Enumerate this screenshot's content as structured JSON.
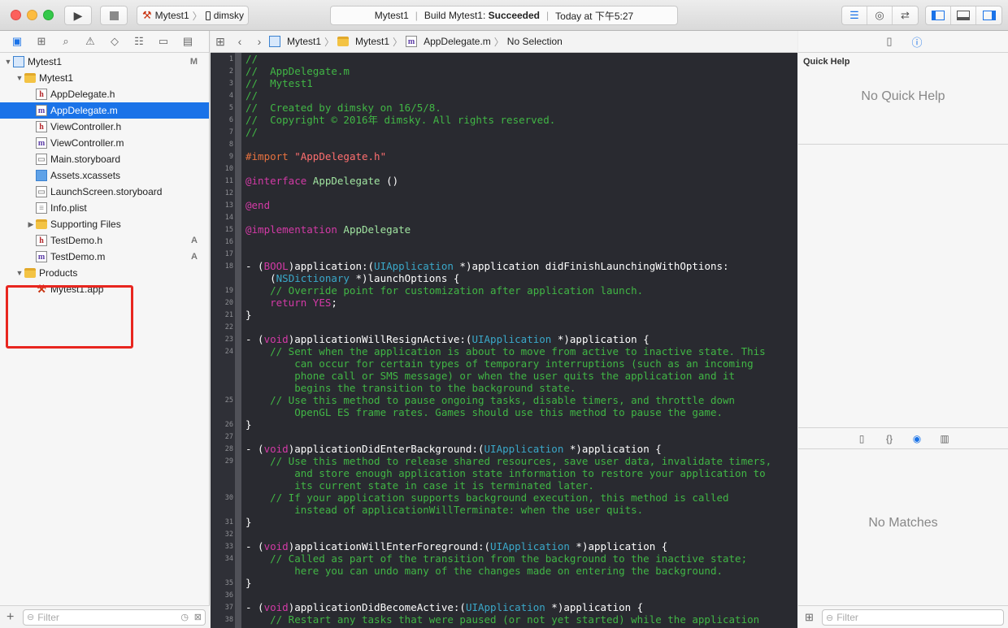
{
  "toolbar": {
    "scheme_name": "Mytest1",
    "device_name": "dimsky",
    "activity_project": "Mytest1",
    "activity_status_prefix": "Build Mytest1:",
    "activity_status": "Succeeded",
    "activity_time": "Today at 下午5:27"
  },
  "navigator": {
    "tabs": [
      "folder-icon",
      "hierarchy-icon",
      "search-icon",
      "warning-icon",
      "test-icon",
      "debug-icon",
      "breakpoint-icon",
      "report-icon"
    ],
    "items": [
      {
        "label": "Mytest1",
        "type": "project",
        "badge": "M"
      },
      {
        "label": "Mytest1",
        "type": "folder",
        "badge": ""
      },
      {
        "label": "AppDelegate.h",
        "type": "h",
        "badge": ""
      },
      {
        "label": "AppDelegate.m",
        "type": "m",
        "badge": ""
      },
      {
        "label": "ViewController.h",
        "type": "h",
        "badge": ""
      },
      {
        "label": "ViewController.m",
        "type": "m",
        "badge": ""
      },
      {
        "label": "Main.storyboard",
        "type": "storyboard",
        "badge": ""
      },
      {
        "label": "Assets.xcassets",
        "type": "xcassets",
        "badge": ""
      },
      {
        "label": "LaunchScreen.storyboard",
        "type": "storyboard",
        "badge": ""
      },
      {
        "label": "Info.plist",
        "type": "plist",
        "badge": ""
      },
      {
        "label": "Supporting Files",
        "type": "folder",
        "badge": ""
      },
      {
        "label": "TestDemo.h",
        "type": "h",
        "badge": "A"
      },
      {
        "label": "TestDemo.m",
        "type": "m",
        "badge": "A"
      },
      {
        "label": "Products",
        "type": "folder",
        "badge": ""
      },
      {
        "label": "Mytest1.app",
        "type": "app",
        "badge": ""
      }
    ],
    "filter_placeholder": "Filter"
  },
  "jumpbar": {
    "project": "Mytest1",
    "group": "Mytest1",
    "file": "AppDelegate.m",
    "selection": "No Selection"
  },
  "editor": {
    "lines": [
      {
        "n": "1",
        "text": "//"
      },
      {
        "n": "2",
        "text": "//  AppDelegate.m"
      },
      {
        "n": "3",
        "text": "//  Mytest1"
      },
      {
        "n": "4",
        "text": "//"
      },
      {
        "n": "5",
        "text": "//  Created by dimsky on 16/5/8."
      },
      {
        "n": "6",
        "text": "//  Copyright © 2016年 dimsky. All rights reserved."
      },
      {
        "n": "7",
        "text": "//"
      },
      {
        "n": "8",
        "text": ""
      },
      {
        "n": "9",
        "text": "#import \"AppDelegate.h\""
      },
      {
        "n": "10",
        "text": ""
      },
      {
        "n": "11",
        "text": "@interface AppDelegate ()"
      },
      {
        "n": "12",
        "text": ""
      },
      {
        "n": "13",
        "text": "@end"
      },
      {
        "n": "14",
        "text": ""
      },
      {
        "n": "15",
        "text": "@implementation AppDelegate"
      },
      {
        "n": "16",
        "text": ""
      },
      {
        "n": "17",
        "text": ""
      },
      {
        "n": "18",
        "text": "- (BOOL)application:(UIApplication *)application didFinishLaunchingWithOptions:"
      },
      {
        "n": "",
        "text": "    (NSDictionary *)launchOptions {"
      },
      {
        "n": "19",
        "text": "    // Override point for customization after application launch."
      },
      {
        "n": "20",
        "text": "    return YES;"
      },
      {
        "n": "21",
        "text": "}"
      },
      {
        "n": "22",
        "text": ""
      },
      {
        "n": "23",
        "text": "- (void)applicationWillResignActive:(UIApplication *)application {"
      },
      {
        "n": "24",
        "text": "    // Sent when the application is about to move from active to inactive state. This"
      },
      {
        "n": "",
        "text": "        can occur for certain types of temporary interruptions (such as an incoming"
      },
      {
        "n": "",
        "text": "        phone call or SMS message) or when the user quits the application and it"
      },
      {
        "n": "",
        "text": "        begins the transition to the background state."
      },
      {
        "n": "25",
        "text": "    // Use this method to pause ongoing tasks, disable timers, and throttle down"
      },
      {
        "n": "",
        "text": "        OpenGL ES frame rates. Games should use this method to pause the game."
      },
      {
        "n": "26",
        "text": "}"
      },
      {
        "n": "27",
        "text": ""
      },
      {
        "n": "28",
        "text": "- (void)applicationDidEnterBackground:(UIApplication *)application {"
      },
      {
        "n": "29",
        "text": "    // Use this method to release shared resources, save user data, invalidate timers,"
      },
      {
        "n": "",
        "text": "        and store enough application state information to restore your application to"
      },
      {
        "n": "",
        "text": "        its current state in case it is terminated later."
      },
      {
        "n": "30",
        "text": "    // If your application supports background execution, this method is called"
      },
      {
        "n": "",
        "text": "        instead of applicationWillTerminate: when the user quits."
      },
      {
        "n": "31",
        "text": "}"
      },
      {
        "n": "32",
        "text": ""
      },
      {
        "n": "33",
        "text": "- (void)applicationWillEnterForeground:(UIApplication *)application {"
      },
      {
        "n": "34",
        "text": "    // Called as part of the transition from the background to the inactive state;"
      },
      {
        "n": "",
        "text": "        here you can undo many of the changes made on entering the background."
      },
      {
        "n": "35",
        "text": "}"
      },
      {
        "n": "36",
        "text": ""
      },
      {
        "n": "37",
        "text": "- (void)applicationDidBecomeActive:(UIApplication *)application {"
      },
      {
        "n": "38",
        "text": "    // Restart any tasks that were paused (or not yet started) while the application"
      }
    ]
  },
  "utilities": {
    "quick_help_title": "Quick Help",
    "quick_help_empty": "No Quick Help",
    "library_empty": "No Matches",
    "filter_placeholder": "Filter"
  },
  "colors": {
    "accent": "#1a73e8",
    "editor_bg": "#292a30",
    "comment": "#41b645",
    "keyword": "#d33aa6",
    "string": "#ff6f6f",
    "highlight_box": "#e8261f"
  }
}
